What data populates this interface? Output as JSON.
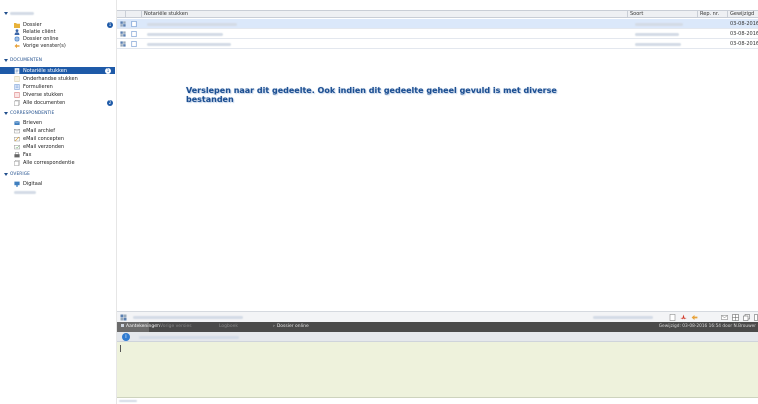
{
  "sidebar": {
    "top_section": {
      "items": [
        {
          "label": "Dossier",
          "icon": "folder-icon",
          "badge": "1"
        },
        {
          "label": "Relatie cliënt",
          "icon": "person-icon"
        },
        {
          "label": "Dossier online",
          "icon": "globe-icon"
        },
        {
          "label": "Vorige venster(s)",
          "icon": "back-arrow-icon"
        }
      ]
    },
    "documenten": {
      "title": "DOCUMENTEN",
      "items": [
        {
          "label": "Notariële stukken",
          "icon": "document-icon",
          "badge": "1",
          "active": true
        },
        {
          "label": "Onderhandse stukken",
          "icon": "document-outline-icon"
        },
        {
          "label": "Formulieren",
          "icon": "form-icon"
        },
        {
          "label": "Diverse stukken",
          "icon": "document-red-icon"
        },
        {
          "label": "Alle documenten",
          "icon": "documents-icon",
          "badge": "2"
        }
      ]
    },
    "correspondentie": {
      "title": "CORRESPONDENTIE",
      "items": [
        {
          "label": "Brieven",
          "icon": "letter-icon"
        },
        {
          "label": "eMail archief",
          "icon": "mail-archive-icon"
        },
        {
          "label": "eMail concepten",
          "icon": "mail-draft-icon"
        },
        {
          "label": "eMail verzonden",
          "icon": "mail-sent-icon"
        },
        {
          "label": "Fax",
          "icon": "fax-icon"
        },
        {
          "label": "Alle correspondentie",
          "icon": "all-correspondence-icon"
        }
      ]
    },
    "overige": {
      "title": "OVERIGE",
      "items": [
        {
          "label": "Digitaal",
          "icon": "digital-icon"
        }
      ]
    }
  },
  "grid": {
    "columns": [
      "Notariële stukken",
      "Soort",
      "Rep. nr.",
      "Gewijzigd"
    ],
    "rows": [
      {
        "date": "03-08-2016",
        "selected": true
      },
      {
        "date": "03-08-2016",
        "selected": false
      },
      {
        "date": "03-08-2016",
        "selected": false
      }
    ]
  },
  "drop_hint": "Verslepen naar dit gedeelte. Ook indien dit gedeelte geheel gevuld is met diverse bestanden",
  "tabs": {
    "items": [
      {
        "label": "Aantekeningen",
        "active": true
      },
      {
        "label": "Vorige versies",
        "active": false
      },
      {
        "label": "Logboek",
        "active": false
      },
      {
        "label": "Dossier online",
        "active": false
      }
    ],
    "status": "Gewijzigd: 03-08-2016 16:54 door N.Brouwer"
  },
  "colors": {
    "accent": "#1e5aa8",
    "hint_text": "#1d4f91",
    "selected_row": "#dbe8fa",
    "note_area": "#eef2dc",
    "tabbar": "#4a4a4a"
  }
}
